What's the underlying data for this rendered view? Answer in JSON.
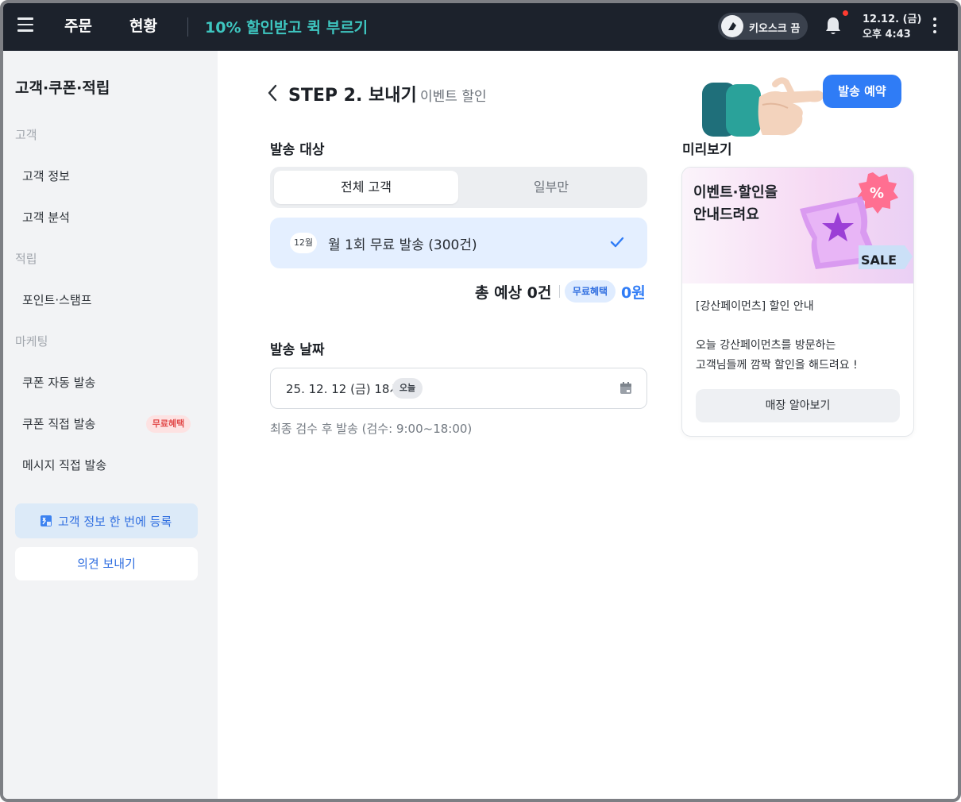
{
  "topbar": {
    "nav": [
      "주문",
      "현황"
    ],
    "promo": "10% 할인받고 퀵 부르기",
    "kiosk_label": "키오스크 끔",
    "date": "12.12. (금)",
    "time": "오후 4:43",
    "colors": {
      "bar": "#1c222c",
      "promo": "#3ec6c0",
      "notification_dot": "#ff3b30"
    }
  },
  "sidebar": {
    "title": "고객·쿠폰·적립",
    "sections": [
      {
        "label": "고객",
        "items": [
          "고객 정보",
          "고객 분석"
        ]
      },
      {
        "label": "적립",
        "items": [
          "포인트·스탬프"
        ]
      },
      {
        "label": "마케팅",
        "items": [
          "쿠폰 자동 발송",
          "쿠폰 직접 발송",
          "메시지 직접 발송"
        ]
      }
    ],
    "coupon_badge": "무료혜택",
    "register_button": "고객 정보 한 번에 등록",
    "feedback_button": "의견 보내기"
  },
  "main": {
    "step_title": "STEP 2. 보내기",
    "step_subtitle": "이벤트 할인",
    "send_button": "발송 예약",
    "target_label": "발송 대상",
    "target_tabs": [
      "전체 고객",
      "일부만"
    ],
    "selected_tab": "전체 고객",
    "free_card": {
      "month": "12월",
      "text": "월 1회 무료 발송 (300건)",
      "checked": true
    },
    "total": {
      "label": "총 예상 0건",
      "badge": "무료혜택",
      "amount": "0원"
    },
    "date_label": "발송 날짜",
    "date_value": "25. 12. 12 (금) 18시",
    "today_chip": "오늘",
    "date_note": "최종 검수 후 발송 (검수: 9:00~18:00)",
    "accent": "#2f7cf6"
  },
  "preview": {
    "label": "미리보기",
    "headline_line1": "이벤트·할인을",
    "headline_line2": "안내드려요",
    "sale_tag": "SALE",
    "subject": "[강산페이먼츠] 할인 안내",
    "body_line1": "오늘 강산페이먼츠를 방문하는",
    "body_line2": "고객님들께 깜짝 할인을 해드려요 !",
    "button": "매장 알아보기"
  }
}
